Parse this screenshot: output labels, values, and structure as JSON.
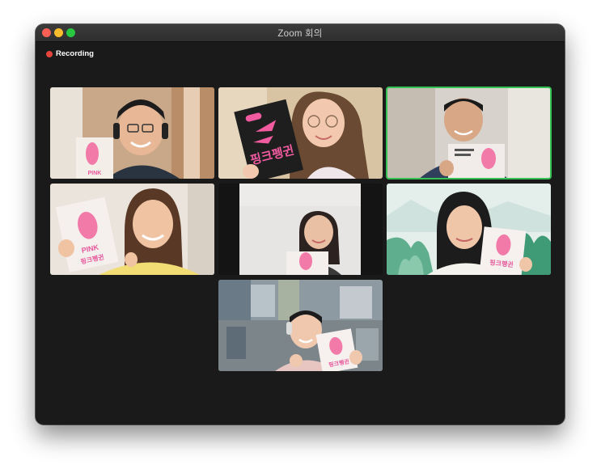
{
  "window": {
    "title": "Zoom 회의"
  },
  "status": {
    "recording_label": "Recording",
    "recording_color": "#e5443b"
  },
  "colors": {
    "active_speaker": "#35c255",
    "window_bg": "#1a1a1a"
  },
  "participants": [
    {
      "book_text": "PINK PENGUIN",
      "active": false
    },
    {
      "book_text": "핑크펭귄",
      "active": false
    },
    {
      "book_text": "",
      "active": true
    },
    {
      "book_text": "핑크펭귄",
      "active": false
    },
    {
      "book_text": "",
      "active": false
    },
    {
      "book_text": "핑크펭귄",
      "active": false
    },
    {
      "book_text": "핑크펭귄",
      "active": false
    }
  ]
}
